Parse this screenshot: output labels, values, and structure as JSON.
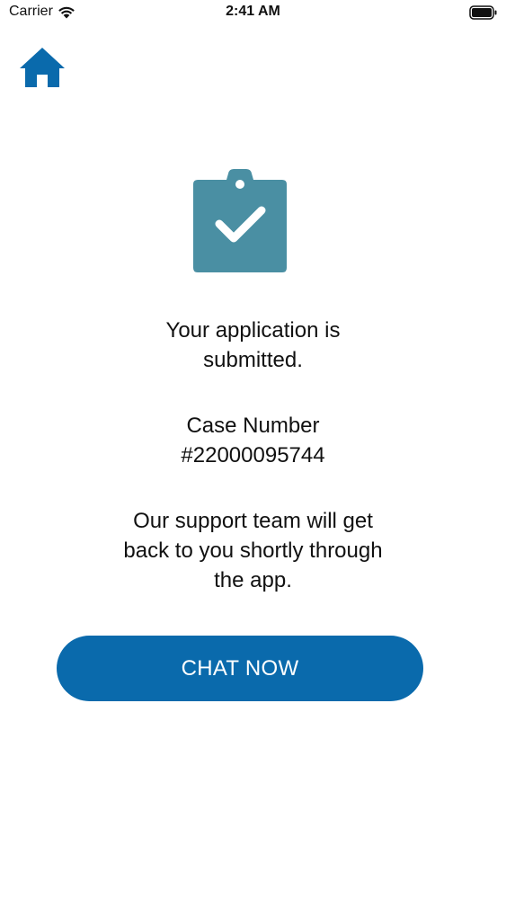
{
  "status_bar": {
    "carrier": "Carrier",
    "time": "2:41 AM",
    "wifi_icon": "wifi-icon",
    "battery_icon": "battery-icon"
  },
  "nav": {
    "home_icon": "home-icon"
  },
  "confirmation": {
    "icon": "clipboard-check-icon",
    "submitted_line1": "Your application is",
    "submitted_line2": "submitted.",
    "case_label": "Case Number",
    "case_number": "#22000095744",
    "support_line1": "Our support team will get",
    "support_line2": "back to you shortly through",
    "support_line3": "the app."
  },
  "actions": {
    "chat_now_label": "CHAT NOW"
  },
  "colors": {
    "primary": "#0a6aac",
    "clipboard": "#4a8fa3",
    "text": "#111111",
    "background": "#ffffff"
  }
}
